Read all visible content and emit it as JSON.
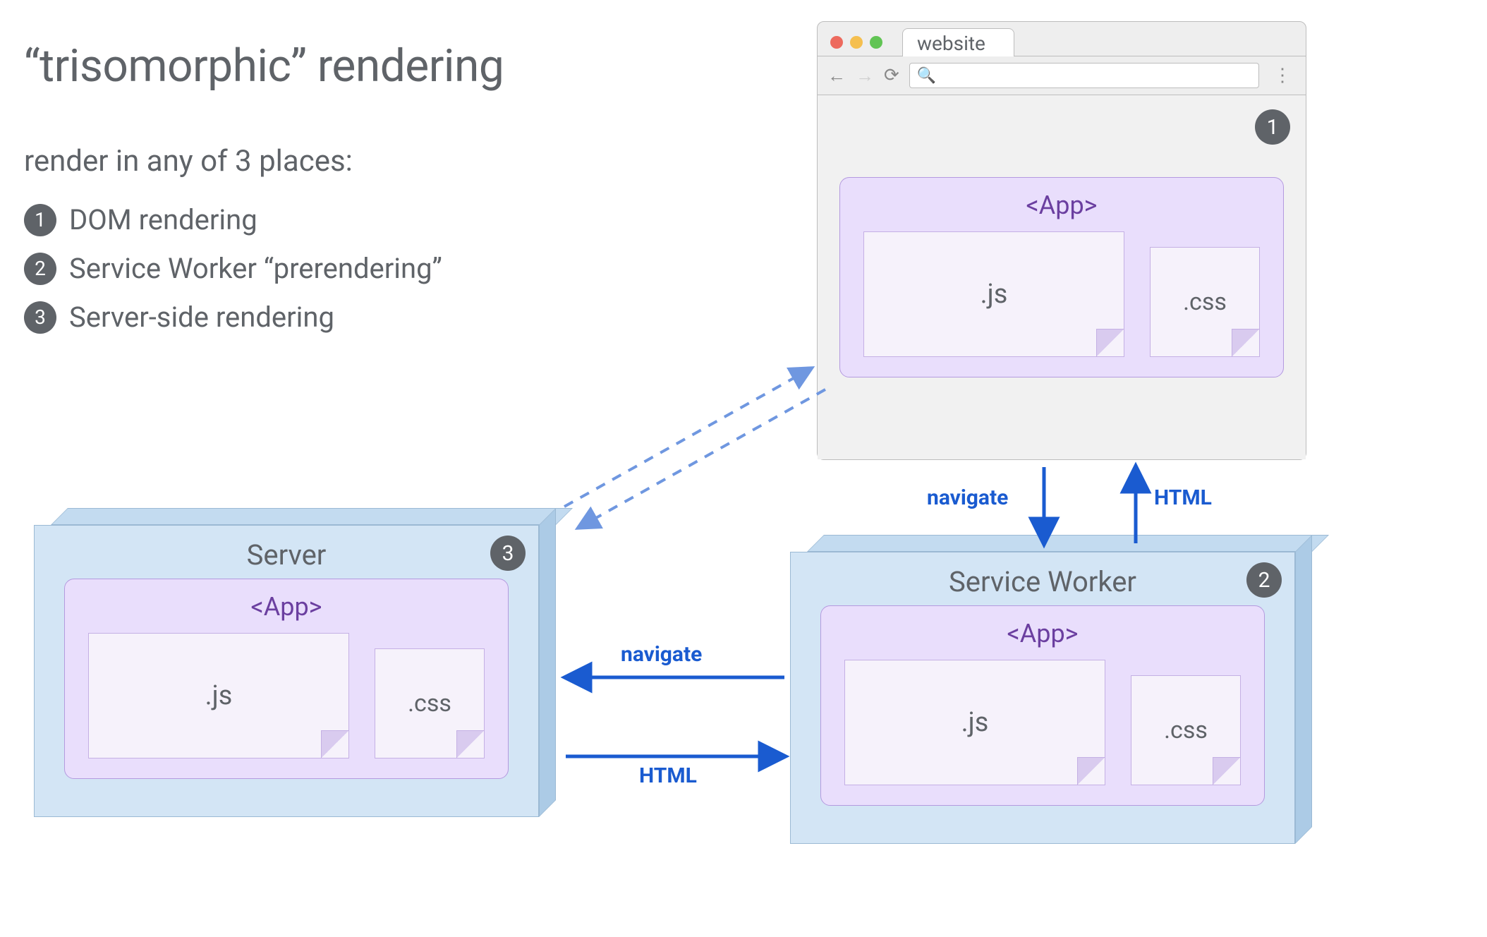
{
  "title": "“trisomorphic” rendering",
  "subtitle": "render in any of 3 places:",
  "list": [
    {
      "n": "1",
      "label": "DOM rendering"
    },
    {
      "n": "2",
      "label": "Service Worker “prerendering”"
    },
    {
      "n": "3",
      "label": "Server-side rendering"
    }
  ],
  "browser": {
    "tab": "website",
    "badge": "1",
    "app": {
      "title": "<App>",
      "js": ".js",
      "css": ".css"
    }
  },
  "server": {
    "title": "Server",
    "badge": "3",
    "app": {
      "title": "<App>",
      "js": ".js",
      "css": ".css"
    }
  },
  "sw": {
    "title": "Service Worker",
    "badge": "2",
    "app": {
      "title": "<App>",
      "js": ".js",
      "css": ".css"
    }
  },
  "arrows": {
    "browser_sw_down": "navigate",
    "browser_sw_up": "HTML",
    "sw_server_left": "navigate",
    "sw_server_right": "HTML"
  },
  "colors": {
    "text": "#5f6368",
    "badge": "#5f6368",
    "arrow": "#1a5bd0",
    "box_fill": "#d3e5f5",
    "box_edge": "#9bb9d4",
    "app_fill": "#e9defc",
    "app_border": "#b49adf",
    "app_title": "#6b3fa0"
  }
}
